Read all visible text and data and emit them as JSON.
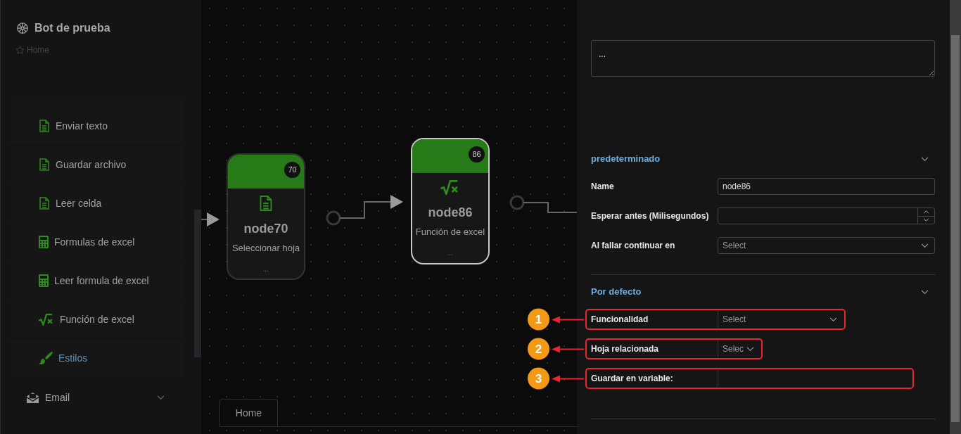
{
  "sidebar": {
    "title": "Bot de prueba",
    "breadcrumb": "Home",
    "items": [
      {
        "label": "Enviar texto",
        "kind": "doc",
        "selected": false
      },
      {
        "label": "Guardar archivo",
        "kind": "doc",
        "selected": false
      },
      {
        "label": "Leer celda",
        "kind": "doc",
        "selected": false
      },
      {
        "label": "Formulas de excel",
        "kind": "calc",
        "selected": false
      },
      {
        "label": "Leer formula de excel",
        "kind": "calc",
        "selected": false
      },
      {
        "label": "Función de excel",
        "kind": "sqrt",
        "selected": false
      },
      {
        "label": "Estilos",
        "kind": "brush",
        "selected": true
      }
    ],
    "groups": [
      {
        "label": "Email",
        "expanded": false
      }
    ]
  },
  "canvas": {
    "nodes": [
      {
        "badge": "70",
        "name": "node70",
        "subtitle": "Seleccionar hoja",
        "footer": "...",
        "kind": "doc",
        "selected": false
      },
      {
        "badge": "86",
        "name": "node86",
        "subtitle": "Función de excel",
        "footer": "...",
        "kind": "sqrt",
        "selected": true
      }
    ],
    "tabs": [
      {
        "label": "Home",
        "selected": true
      }
    ]
  },
  "panel": {
    "description": "...",
    "sections": [
      {
        "title": "predeterminado",
        "expanded": true,
        "fields": [
          {
            "label": "Name",
            "kind": "text",
            "value": "node86"
          },
          {
            "label": "Esperar antes (Milisegundos)",
            "kind": "number"
          },
          {
            "label": "Al fallar continuar en",
            "kind": "select",
            "placeholder": "Select"
          }
        ]
      },
      {
        "title": "Por defecto",
        "expanded": true,
        "fields": [
          {
            "label": "Funcionalidad",
            "kind": "select",
            "placeholder": "Select",
            "callout": "1"
          },
          {
            "label": "Hoja relacionada",
            "kind": "select",
            "placeholder": "Selec",
            "callout": "2"
          },
          {
            "label": "Guardar en variable:",
            "kind": "text",
            "callout": "3"
          }
        ]
      }
    ]
  }
}
